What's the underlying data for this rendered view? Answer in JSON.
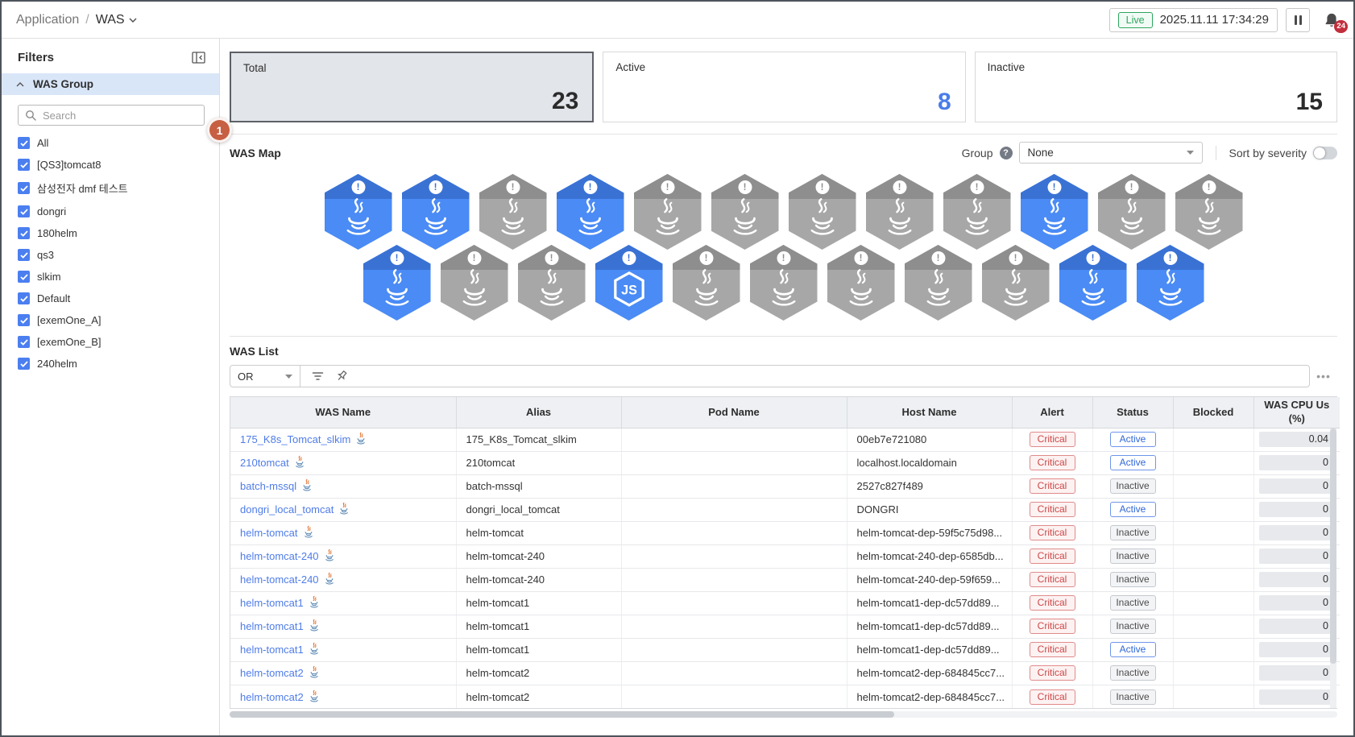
{
  "topbar": {
    "breadcrumb_section": "Application",
    "breadcrumb_sep": "/",
    "breadcrumb_current": "WAS",
    "live_label": "Live",
    "timestamp": "2025.11.11 17:34:29",
    "notification_count": "24"
  },
  "annotation_step": "1",
  "icons": {
    "help": "?",
    "hex_alert": "!",
    "more": "•••"
  },
  "sidebar": {
    "title": "Filters",
    "group_title": "WAS Group",
    "search_placeholder": "Search",
    "items": [
      {
        "label": "All",
        "checked": true
      },
      {
        "label": "[QS3]tomcat8",
        "checked": true
      },
      {
        "label": "삼성전자 dmf 테스트",
        "checked": true
      },
      {
        "label": "dongri",
        "checked": true
      },
      {
        "label": "180helm",
        "checked": true
      },
      {
        "label": "qs3",
        "checked": true
      },
      {
        "label": "slkim",
        "checked": true
      },
      {
        "label": "Default",
        "checked": true
      },
      {
        "label": "[exemOne_A]",
        "checked": true
      },
      {
        "label": "[exemOne_B]",
        "checked": true
      },
      {
        "label": "240helm",
        "checked": true
      }
    ]
  },
  "summary_cards": [
    {
      "label": "Total",
      "value": "23",
      "selected": true
    },
    {
      "label": "Active",
      "value": "8",
      "selected": false,
      "value_color": "#4a7de8"
    },
    {
      "label": "Inactive",
      "value": "15",
      "selected": false
    }
  ],
  "was_map": {
    "title": "WAS Map",
    "group_label": "Group",
    "group_value": "None",
    "sort_label": "Sort by severity",
    "sort_on": false,
    "hex_colors": {
      "active_body": "#4a8bf5",
      "active_band": "#3a72d4",
      "inactive_body": "#a7a7a7",
      "inactive_band": "#8e8e8e"
    },
    "rows": [
      [
        "active",
        "active",
        "inactive",
        "active",
        "inactive",
        "inactive",
        "inactive",
        "inactive",
        "inactive",
        "active",
        "inactive",
        "inactive"
      ],
      [
        "active",
        "inactive",
        "inactive",
        "active-node",
        "inactive",
        "inactive",
        "inactive",
        "inactive",
        "inactive",
        "active",
        "active"
      ]
    ]
  },
  "was_list": {
    "title": "WAS List",
    "operator": "OR",
    "columns": [
      "WAS Name",
      "Alias",
      "Pod Name",
      "Host Name",
      "Alert",
      "Status",
      "Blocked",
      "WAS CPU Us (%)"
    ],
    "rows": [
      {
        "was_name": "175_K8s_Tomcat_slkim",
        "alias": "175_K8s_Tomcat_slkim",
        "pod_name": "",
        "host_name": "00eb7e721080",
        "alert": "Critical",
        "status": "Active",
        "blocked": "",
        "cpu": "0.04"
      },
      {
        "was_name": "210tomcat",
        "alias": "210tomcat",
        "pod_name": "",
        "host_name": "localhost.localdomain",
        "alert": "Critical",
        "status": "Active",
        "blocked": "",
        "cpu": "0"
      },
      {
        "was_name": "batch-mssql",
        "alias": "batch-mssql",
        "pod_name": "",
        "host_name": "2527c827f489",
        "alert": "Critical",
        "status": "Inactive",
        "blocked": "",
        "cpu": "0"
      },
      {
        "was_name": "dongri_local_tomcat",
        "alias": "dongri_local_tomcat",
        "pod_name": "",
        "host_name": "DONGRI",
        "alert": "Critical",
        "status": "Active",
        "blocked": "",
        "cpu": "0"
      },
      {
        "was_name": "helm-tomcat",
        "alias": "helm-tomcat",
        "pod_name": "",
        "host_name": "helm-tomcat-dep-59f5c75d98...",
        "alert": "Critical",
        "status": "Inactive",
        "blocked": "",
        "cpu": "0"
      },
      {
        "was_name": "helm-tomcat-240",
        "alias": "helm-tomcat-240",
        "pod_name": "",
        "host_name": "helm-tomcat-240-dep-6585db...",
        "alert": "Critical",
        "status": "Inactive",
        "blocked": "",
        "cpu": "0"
      },
      {
        "was_name": "helm-tomcat-240",
        "alias": "helm-tomcat-240",
        "pod_name": "",
        "host_name": "helm-tomcat-240-dep-59f659...",
        "alert": "Critical",
        "status": "Inactive",
        "blocked": "",
        "cpu": "0"
      },
      {
        "was_name": "helm-tomcat1",
        "alias": "helm-tomcat1",
        "pod_name": "",
        "host_name": "helm-tomcat1-dep-dc57dd89...",
        "alert": "Critical",
        "status": "Inactive",
        "blocked": "",
        "cpu": "0"
      },
      {
        "was_name": "helm-tomcat1",
        "alias": "helm-tomcat1",
        "pod_name": "",
        "host_name": "helm-tomcat1-dep-dc57dd89...",
        "alert": "Critical",
        "status": "Inactive",
        "blocked": "",
        "cpu": "0"
      },
      {
        "was_name": "helm-tomcat1",
        "alias": "helm-tomcat1",
        "pod_name": "",
        "host_name": "helm-tomcat1-dep-dc57dd89...",
        "alert": "Critical",
        "status": "Active",
        "blocked": "",
        "cpu": "0"
      },
      {
        "was_name": "helm-tomcat2",
        "alias": "helm-tomcat2",
        "pod_name": "",
        "host_name": "helm-tomcat2-dep-684845cc7...",
        "alert": "Critical",
        "status": "Inactive",
        "blocked": "",
        "cpu": "0"
      },
      {
        "was_name": "helm-tomcat2",
        "alias": "helm-tomcat2",
        "pod_name": "",
        "host_name": "helm-tomcat2-dep-684845cc7...",
        "alert": "Critical",
        "status": "Inactive",
        "blocked": "",
        "cpu": "0"
      }
    ]
  }
}
